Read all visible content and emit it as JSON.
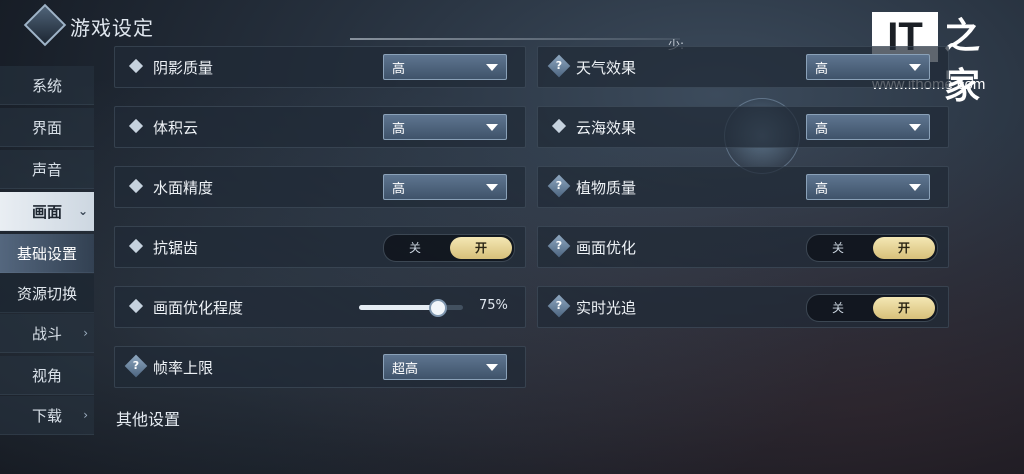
{
  "header": {
    "title": "游戏设定",
    "hint": "少:"
  },
  "watermark": {
    "it": "IT",
    "cn": "之家",
    "url": "www.ithome.com"
  },
  "sidebar": {
    "items": [
      {
        "label": "系统",
        "arrow": ""
      },
      {
        "label": "界面",
        "arrow": ""
      },
      {
        "label": "声音",
        "arrow": ""
      },
      {
        "label": "画面",
        "arrow": "⌄"
      },
      {
        "label": "基础设置",
        "arrow": ""
      },
      {
        "label": "资源切换",
        "arrow": ""
      },
      {
        "label": "战斗",
        "arrow": "›"
      },
      {
        "label": "视角",
        "arrow": ""
      },
      {
        "label": "下载",
        "arrow": "›"
      }
    ]
  },
  "settings": {
    "shadow": {
      "label": "阴影质量",
      "value": "高"
    },
    "weather": {
      "label": "天气效果",
      "value": "高"
    },
    "volumetric_cloud": {
      "label": "体积云",
      "value": "高"
    },
    "cloud_sea": {
      "label": "云海效果",
      "value": "高"
    },
    "water": {
      "label": "水面精度",
      "value": "高"
    },
    "vegetation": {
      "label": "植物质量",
      "value": "高"
    },
    "antialias": {
      "label": "抗锯齿",
      "off": "关",
      "on": "开",
      "state": "on"
    },
    "optimize": {
      "label": "画面优化",
      "off": "关",
      "on": "开",
      "state": "on"
    },
    "optimize_level": {
      "label": "画面优化程度",
      "value": "75%",
      "fraction": 0.75
    },
    "raytracing": {
      "label": "实时光追",
      "off": "关",
      "on": "开",
      "state": "on"
    },
    "framerate": {
      "label": "帧率上限",
      "value": "超高"
    }
  },
  "sections": {
    "other": "其他设置"
  }
}
